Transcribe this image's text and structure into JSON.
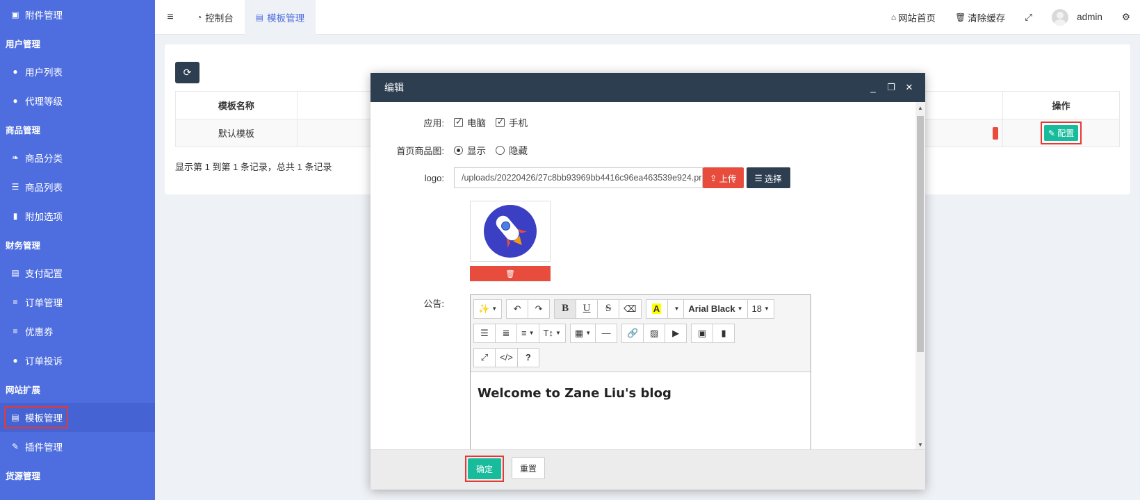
{
  "sidebar": {
    "items": [
      {
        "type": "item",
        "icon": "image-icon",
        "glyph": "▣",
        "label": "附件管理"
      },
      {
        "type": "group",
        "label": "用户管理"
      },
      {
        "type": "item",
        "icon": "user-icon",
        "glyph": "●",
        "label": "用户列表"
      },
      {
        "type": "item",
        "icon": "user-icon",
        "glyph": "●",
        "label": "代理等级"
      },
      {
        "type": "group",
        "label": "商品管理"
      },
      {
        "type": "item",
        "icon": "leaf-icon",
        "glyph": "❧",
        "label": "商品分类"
      },
      {
        "type": "item",
        "icon": "list-icon",
        "glyph": "☰",
        "label": "商品列表"
      },
      {
        "type": "item",
        "icon": "bookmark-icon",
        "glyph": "▮",
        "label": "附加选项"
      },
      {
        "type": "group",
        "label": "财务管理"
      },
      {
        "type": "item",
        "icon": "credit-card-icon",
        "glyph": "▤",
        "label": "支付配置"
      },
      {
        "type": "item",
        "icon": "bars-icon",
        "glyph": "≡",
        "label": "订单管理"
      },
      {
        "type": "item",
        "icon": "bars-icon",
        "glyph": "≡",
        "label": "优惠券"
      },
      {
        "type": "item",
        "icon": "user-icon",
        "glyph": "●",
        "label": "订单投诉"
      },
      {
        "type": "group",
        "label": "网站扩展"
      },
      {
        "type": "item",
        "icon": "template-icon",
        "glyph": "▤",
        "label": "模板管理",
        "active": true
      },
      {
        "type": "item",
        "icon": "plug-icon",
        "glyph": "✎",
        "label": "插件管理"
      },
      {
        "type": "group",
        "label": "货源管理"
      }
    ]
  },
  "topbar": {
    "menu_glyph": "≡",
    "tabs": [
      {
        "label": "控制台",
        "glyph": "◔",
        "icon": "dashboard-icon"
      },
      {
        "label": "模板管理",
        "glyph": "▤",
        "icon": "template-icon",
        "active": true
      }
    ],
    "home_label": "网站首页",
    "home_glyph": "⌂",
    "clear_cache_label": "清除缓存",
    "clear_cache_glyph": "🗑",
    "fullscreen_glyph": "⤢",
    "user_name": "admin",
    "settings_glyph": "⚙"
  },
  "card": {
    "refresh_glyph": "⟳",
    "columns": [
      "模板名称",
      "",
      "",
      "操作"
    ],
    "rows": [
      {
        "name": "默认模板",
        "action": "配置",
        "action_glyph": "✎"
      }
    ],
    "page_info": "显示第 1 到第 1 条记录，总共 1 条记录"
  },
  "modal": {
    "title": "编辑",
    "min_glyph": "_",
    "max_glyph": "❐",
    "close_glyph": "✕",
    "apply_label": "应用:",
    "apply_options": [
      {
        "label": "电脑",
        "checked": true
      },
      {
        "label": "手机",
        "checked": true
      }
    ],
    "home_img_label": "首页商品图:",
    "home_img_options": [
      {
        "label": "显示",
        "checked": true
      },
      {
        "label": "隐藏",
        "checked": false
      }
    ],
    "logo_label": "logo:",
    "logo_value": "/uploads/20220426/27c8bb93969bb4416c96ea463539e924.pr",
    "upload_label": "上传",
    "upload_glyph": "⇪",
    "select_label": "选择",
    "select_glyph": "☰",
    "delete_glyph": "🗑",
    "notice_label": "公告:",
    "editor": {
      "font_name": "Arial Black",
      "font_size": "18",
      "content": "Welcome to Zane Liu's blog"
    },
    "ok_label": "确定",
    "reset_label": "重置"
  },
  "colors": {
    "sidebar_bg": "#4e6ee0",
    "dark_header": "#2c3e50",
    "success": "#18bc9c",
    "danger": "#e74c3c",
    "highlight_border": "#e53935"
  }
}
